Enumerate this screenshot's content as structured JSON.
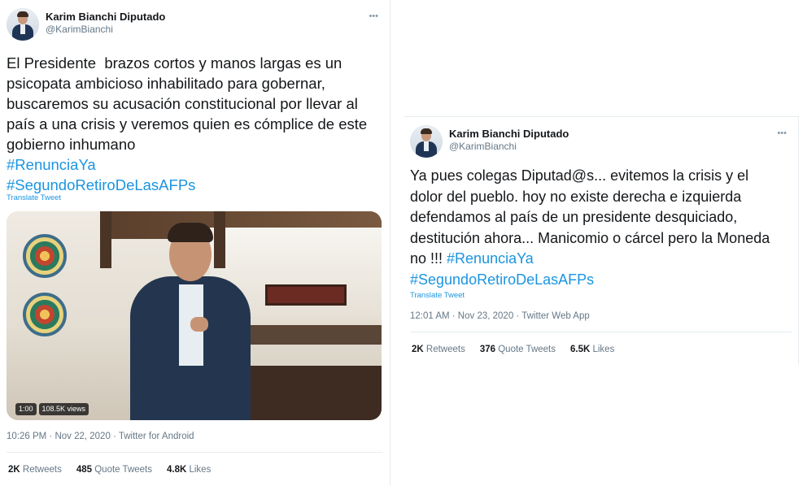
{
  "tweet_left": {
    "author": {
      "display_name": "Karim Bianchi Diputado",
      "handle": "@KarimBianchi"
    },
    "more_icon": "more-options-icon",
    "text": "El Presidente  brazos cortos y manos largas es un\npsicopata ambicioso inhabilitado para gobernar,\nbuscaremos su acusación constitucional por llevar al\npaís a una crisis y veremos quien es cómplice de este\ngobierno inhumano",
    "hashtags": [
      "#RenunciaYa",
      "#SegundoRetiroDeLasAFPs"
    ],
    "translate": "Translate Tweet",
    "video": {
      "duration": "1:00",
      "views": "108.5K views"
    },
    "timestamp": "10:26 PM · Nov 22, 2020 · Twitter for Android",
    "stats": {
      "retweets_count": "2K",
      "retweets_label": "Retweets",
      "quotes_count": "485",
      "quotes_label": "Quote Tweets",
      "likes_count": "4.8K",
      "likes_label": "Likes"
    }
  },
  "tweet_right": {
    "author": {
      "display_name": "Karim Bianchi Diputado",
      "handle": "@KarimBianchi"
    },
    "more_icon": "more-options-icon",
    "text": "Ya pues colegas Diputad@s... evitemos la crisis y el\ndolor del pueblo. hoy no existe derecha e izquierda\ndefendamos al país de un presidente desquiciado,\ndestitución ahora... Manicomio o cárcel pero la Moneda\nno !!! ",
    "hashtags": [
      "#RenunciaYa",
      "#SegundoRetiroDeLasAFPs"
    ],
    "translate": "Translate Tweet",
    "timestamp": "12:01 AM · Nov 23, 2020 · Twitter Web App",
    "stats": {
      "retweets_count": "2K",
      "retweets_label": "Retweets",
      "quotes_count": "376",
      "quotes_label": "Quote Tweets",
      "likes_count": "6.5K",
      "likes_label": "Likes"
    }
  },
  "colors": {
    "link": "#1b95e0",
    "secondary": "#657786",
    "primary": "#14171a",
    "border": "#e6ecf0"
  }
}
